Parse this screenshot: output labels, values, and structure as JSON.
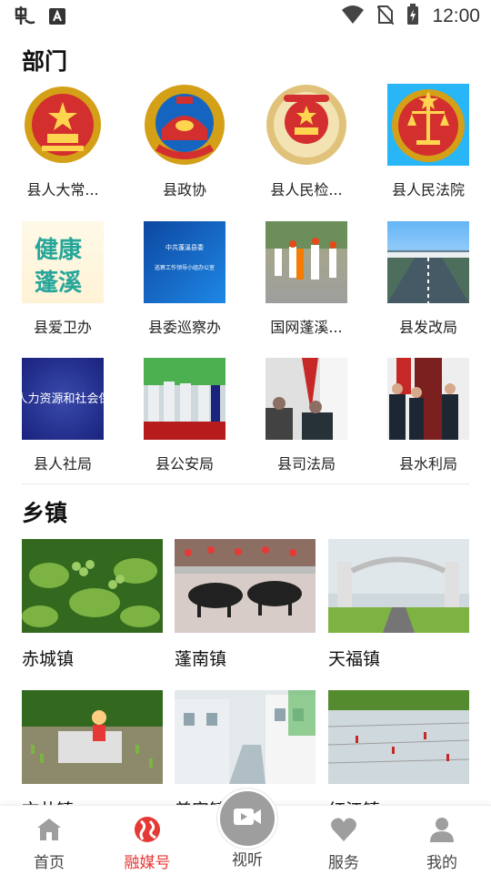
{
  "status_bar": {
    "time": "12:00"
  },
  "departments": {
    "title": "部门",
    "items": [
      {
        "label": "县人大常..."
      },
      {
        "label": "县政协"
      },
      {
        "label": "县人民检..."
      },
      {
        "label": "县人民法院"
      },
      {
        "label": "县爱卫办",
        "thumb_text": "健康\n蓬溪"
      },
      {
        "label": "县委巡察办",
        "thumb_text_1": "中共蓬溪县委",
        "thumb_text_2": "巡察工作领导小组办公室"
      },
      {
        "label": "国网蓬溪..."
      },
      {
        "label": "县发改局"
      },
      {
        "label": "县人社局",
        "thumb_text": "人力资源和社会保障"
      },
      {
        "label": "县公安局"
      },
      {
        "label": "县司法局"
      },
      {
        "label": "县水利局"
      }
    ]
  },
  "towns": {
    "title": "乡镇",
    "items": [
      {
        "label": "赤城镇"
      },
      {
        "label": "蓬南镇"
      },
      {
        "label": "天福镇"
      },
      {
        "label": "文井镇"
      },
      {
        "label": "普安镇"
      },
      {
        "label": "红江镇"
      }
    ]
  },
  "tabbar": {
    "home": "首页",
    "media": "融媒号",
    "video": "视听",
    "service": "服务",
    "mine": "我的"
  },
  "colors": {
    "accent": "#e53935",
    "tab_inactive": "#9e9e9e"
  }
}
